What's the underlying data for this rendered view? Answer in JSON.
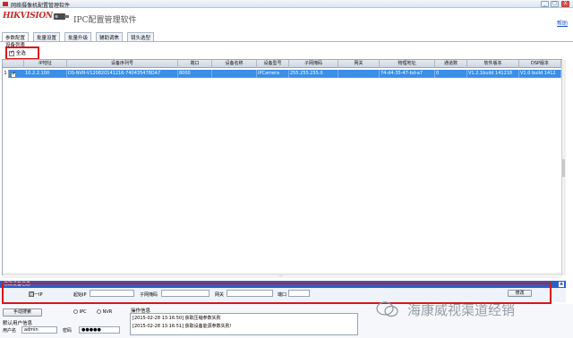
{
  "window": {
    "title": "网络摄像机配置管理软件",
    "controls": [
      "_",
      "□",
      "X"
    ]
  },
  "header": {
    "brand": "HIKVISION",
    "product_title": "IPC配置管理软件",
    "help_link": "帮助"
  },
  "tabs": [
    {
      "label": "参数配置",
      "active": true
    },
    {
      "label": "批量设置",
      "active": false
    },
    {
      "label": "批量升级",
      "active": false
    },
    {
      "label": "辅助调焦",
      "active": false
    },
    {
      "label": "镜头选型",
      "active": false
    }
  ],
  "device_list": {
    "section_label": "设备列表",
    "select_all_label": "全选",
    "select_all_checked": true,
    "columns": [
      "IP地址",
      "设备序列号",
      "端口",
      "设备名称",
      "设备型号",
      "子网掩码",
      "网关",
      "物理地址",
      "通道数",
      "软件版本",
      "DSP版本"
    ],
    "rows": [
      {
        "index": "1",
        "checked": true,
        "cells": [
          "10.2.2.100",
          "DS-NVR-V1208201412​16-740435478DA7",
          "8000",
          "",
          "IPCamera",
          "255.255.255.0",
          "",
          "74-d4-35-47-bd-a7",
          "0",
          "V1.2.1build 141218",
          "V1.0 build 1412"
        ]
      }
    ],
    "selected_row_color": "#3b8fe6"
  },
  "modify_panel": {
    "title": "修改设备信息",
    "dhcp_label": "同一IP",
    "start_ip_label": "起始IP",
    "subnet_label": "子网掩码",
    "gateway_label": "网关",
    "port_label": "端口",
    "modify_button": "修改",
    "collapse_icon": "▲"
  },
  "bottom": {
    "search_button": "手动搜索",
    "radio_options": [
      "IPC",
      "NVR"
    ],
    "user_info_label": "默认用户信息",
    "username_label": "用户名",
    "username_value": "admin",
    "password_label": "密码",
    "password_value": "●●●●●",
    "log_title": "操作信息",
    "log_lines": [
      "[2015-02-28 13:16:50] 获取压缩参数失败",
      "[2015-02-28 13:16:51] 获取设备能源参数失败!"
    ],
    "watermark": "海康威视渠道经销"
  },
  "colors": {
    "brand_red": "#c62828",
    "selection_blue": "#3b8fe6",
    "panel_blue": "#2a5fc6",
    "highlight_red": "#d9151b"
  }
}
